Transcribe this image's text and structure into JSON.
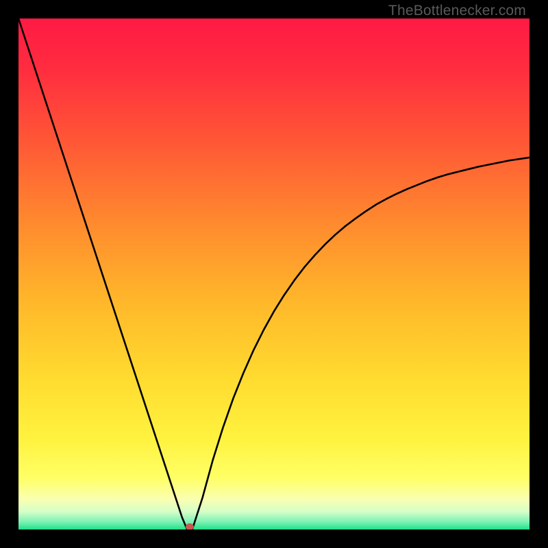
{
  "watermark": "TheBottlenecker.com",
  "chart_data": {
    "type": "line",
    "title": "",
    "xlabel": "",
    "ylabel": "",
    "xlim": [
      0,
      100
    ],
    "ylim": [
      0,
      100
    ],
    "x": [
      0,
      2,
      4,
      6,
      8,
      10,
      12,
      14,
      16,
      18,
      20,
      22,
      24,
      26,
      28,
      30,
      32,
      33,
      34,
      36,
      38,
      40,
      42,
      44,
      46,
      48,
      50,
      52,
      54,
      56,
      58,
      60,
      62,
      64,
      66,
      68,
      70,
      72,
      74,
      76,
      78,
      80,
      82,
      84,
      86,
      88,
      90,
      92,
      94,
      96,
      98,
      100
    ],
    "y": [
      100,
      93.9,
      87.8,
      81.7,
      75.6,
      69.5,
      63.4,
      57.3,
      51.2,
      45.1,
      39.0,
      32.9,
      26.8,
      20.7,
      14.6,
      8.5,
      2.4,
      0,
      0,
      6.2,
      13.5,
      19.9,
      25.6,
      30.6,
      35.1,
      39.1,
      42.7,
      45.9,
      48.8,
      51.4,
      53.7,
      55.8,
      57.7,
      59.4,
      60.9,
      62.3,
      63.6,
      64.7,
      65.7,
      66.6,
      67.4,
      68.2,
      68.9,
      69.5,
      70.0,
      70.5,
      71.0,
      71.4,
      71.8,
      72.2,
      72.5,
      72.8
    ],
    "marker": {
      "x": 33.5,
      "y": 0
    },
    "gradient_stops": [
      {
        "offset": 0.0,
        "color": "#ff1a44"
      },
      {
        "offset": 0.1,
        "color": "#ff2d3f"
      },
      {
        "offset": 0.25,
        "color": "#ff5a35"
      },
      {
        "offset": 0.4,
        "color": "#ff8a2e"
      },
      {
        "offset": 0.55,
        "color": "#ffb62a"
      },
      {
        "offset": 0.7,
        "color": "#ffda2f"
      },
      {
        "offset": 0.82,
        "color": "#fff23e"
      },
      {
        "offset": 0.9,
        "color": "#ffff66"
      },
      {
        "offset": 0.94,
        "color": "#faffb0"
      },
      {
        "offset": 0.965,
        "color": "#d5ffc8"
      },
      {
        "offset": 0.985,
        "color": "#7df2b4"
      },
      {
        "offset": 1.0,
        "color": "#1fe08a"
      }
    ]
  }
}
